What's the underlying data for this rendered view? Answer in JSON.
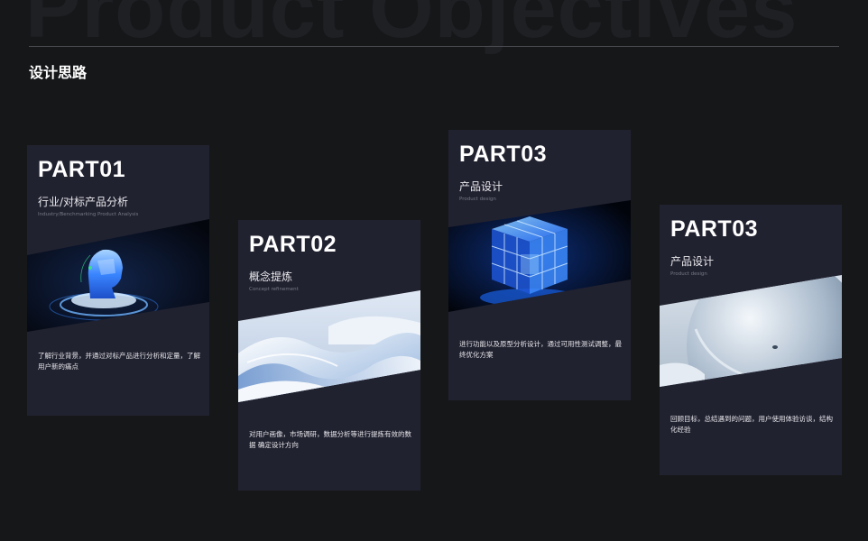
{
  "background_title": "Product Objectives",
  "section_heading": "设计思路",
  "cards": [
    {
      "part": "PART01",
      "title": "行业/对标产品分析",
      "subtitle": "Industry/Benchmarking Product Analysis",
      "description": "了解行业背景，并通过对标产品进行分析和定量，了解用户新的痛点",
      "image": "crystal-head-illustration"
    },
    {
      "part": "PART02",
      "title": "概念提炼",
      "subtitle": "Concept refinement",
      "description": "对用户画像，市场调研，数据分析等进行提炼有效的数据 确定设计方向",
      "image": "white-waves-illustration"
    },
    {
      "part": "PART03",
      "title": "产品设计",
      "subtitle": "Product design",
      "description": "进行功能以及原型分析设计，通过可用性测试调整，最终优化方案",
      "image": "glowing-cube-illustration"
    },
    {
      "part": "PART03",
      "title": "产品设计",
      "subtitle": "Product design",
      "description": "回顾目标，总结遇到的问题，用户使用体验访谈，结构化经验",
      "image": "glass-sphere-illustration"
    }
  ],
  "colors": {
    "page_background": "#161719",
    "card_background": "#212230",
    "divider": "#4a4b50",
    "accent_blue": "#3b8bff"
  }
}
